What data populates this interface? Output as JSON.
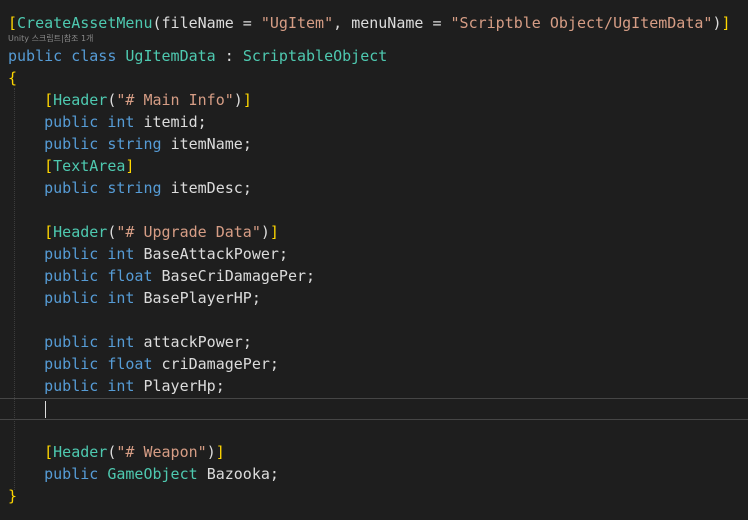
{
  "editor": {
    "codelens": "Unity 스크립트|참조 1개",
    "lines": [
      {
        "t": [
          [
            "br",
            "["
          ],
          [
            "ty",
            "CreateAssetMenu"
          ],
          [
            "pu",
            "("
          ],
          [
            "id",
            "fileName"
          ],
          [
            "pu",
            " = "
          ],
          [
            "st",
            "\"UgItem\""
          ],
          [
            "pu",
            ", "
          ],
          [
            "id",
            "menuName"
          ],
          [
            "pu",
            " = "
          ],
          [
            "st",
            "\"Scriptble Object/UgItemData\""
          ],
          [
            "pu",
            ")"
          ],
          [
            "br",
            "]"
          ]
        ]
      },
      {
        "t": [
          [
            "kw",
            "public"
          ],
          [
            "pu",
            " "
          ],
          [
            "kw",
            "class"
          ],
          [
            "pu",
            " "
          ],
          [
            "ty",
            "UgItemData"
          ],
          [
            "pu",
            " : "
          ],
          [
            "ty",
            "ScriptableObject"
          ]
        ]
      },
      {
        "t": [
          [
            "br",
            "{"
          ]
        ]
      },
      {
        "t": [
          [
            "pu",
            "    "
          ],
          [
            "br",
            "["
          ],
          [
            "ty",
            "Header"
          ],
          [
            "pu",
            "("
          ],
          [
            "st",
            "\"# Main Info\""
          ],
          [
            "pu",
            ")"
          ],
          [
            "br",
            "]"
          ]
        ]
      },
      {
        "t": [
          [
            "pu",
            "    "
          ],
          [
            "kw",
            "public"
          ],
          [
            "pu",
            " "
          ],
          [
            "kw",
            "int"
          ],
          [
            "pu",
            " "
          ],
          [
            "id",
            "itemid"
          ],
          [
            "pu",
            ";"
          ]
        ]
      },
      {
        "t": [
          [
            "pu",
            "    "
          ],
          [
            "kw",
            "public"
          ],
          [
            "pu",
            " "
          ],
          [
            "kw",
            "string"
          ],
          [
            "pu",
            " "
          ],
          [
            "id",
            "itemName"
          ],
          [
            "pu",
            ";"
          ]
        ]
      },
      {
        "t": [
          [
            "pu",
            "    "
          ],
          [
            "br",
            "["
          ],
          [
            "ty",
            "TextArea"
          ],
          [
            "br",
            "]"
          ]
        ]
      },
      {
        "t": [
          [
            "pu",
            "    "
          ],
          [
            "kw",
            "public"
          ],
          [
            "pu",
            " "
          ],
          [
            "kw",
            "string"
          ],
          [
            "pu",
            " "
          ],
          [
            "id",
            "itemDesc"
          ],
          [
            "pu",
            ";"
          ]
        ]
      },
      {
        "t": []
      },
      {
        "t": [
          [
            "pu",
            "    "
          ],
          [
            "br",
            "["
          ],
          [
            "ty",
            "Header"
          ],
          [
            "pu",
            "("
          ],
          [
            "st",
            "\"# Upgrade Data\""
          ],
          [
            "pu",
            ")"
          ],
          [
            "br",
            "]"
          ]
        ]
      },
      {
        "t": [
          [
            "pu",
            "    "
          ],
          [
            "kw",
            "public"
          ],
          [
            "pu",
            " "
          ],
          [
            "kw",
            "int"
          ],
          [
            "pu",
            " "
          ],
          [
            "id",
            "BaseAttackPower"
          ],
          [
            "pu",
            ";"
          ]
        ]
      },
      {
        "t": [
          [
            "pu",
            "    "
          ],
          [
            "kw",
            "public"
          ],
          [
            "pu",
            " "
          ],
          [
            "kw",
            "float"
          ],
          [
            "pu",
            " "
          ],
          [
            "id",
            "BaseCriDamagePer"
          ],
          [
            "pu",
            ";"
          ]
        ]
      },
      {
        "t": [
          [
            "pu",
            "    "
          ],
          [
            "kw",
            "public"
          ],
          [
            "pu",
            " "
          ],
          [
            "kw",
            "int"
          ],
          [
            "pu",
            " "
          ],
          [
            "id",
            "BasePlayerHP"
          ],
          [
            "pu",
            ";"
          ]
        ]
      },
      {
        "t": []
      },
      {
        "t": [
          [
            "pu",
            "    "
          ],
          [
            "kw",
            "public"
          ],
          [
            "pu",
            " "
          ],
          [
            "kw",
            "int"
          ],
          [
            "pu",
            " "
          ],
          [
            "id",
            "attackPower"
          ],
          [
            "pu",
            ";"
          ]
        ]
      },
      {
        "t": [
          [
            "pu",
            "    "
          ],
          [
            "kw",
            "public"
          ],
          [
            "pu",
            " "
          ],
          [
            "kw",
            "float"
          ],
          [
            "pu",
            " "
          ],
          [
            "id",
            "criDamagePer"
          ],
          [
            "pu",
            ";"
          ]
        ]
      },
      {
        "t": [
          [
            "pu",
            "    "
          ],
          [
            "kw",
            "public"
          ],
          [
            "pu",
            " "
          ],
          [
            "kw",
            "int"
          ],
          [
            "pu",
            " "
          ],
          [
            "id",
            "PlayerHp"
          ],
          [
            "pu",
            ";"
          ]
        ]
      },
      {
        "t": []
      },
      {
        "t": []
      },
      {
        "t": [
          [
            "pu",
            "    "
          ],
          [
            "br",
            "["
          ],
          [
            "ty",
            "Header"
          ],
          [
            "pu",
            "("
          ],
          [
            "st",
            "\"# Weapon\""
          ],
          [
            "pu",
            ")"
          ],
          [
            "br",
            "]"
          ]
        ]
      },
      {
        "t": [
          [
            "pu",
            "    "
          ],
          [
            "kw",
            "public"
          ],
          [
            "pu",
            " "
          ],
          [
            "ty",
            "GameObject"
          ],
          [
            "pu",
            " "
          ],
          [
            "id",
            "Bazooka"
          ],
          [
            "pu",
            ";"
          ]
        ]
      },
      {
        "t": [
          [
            "br",
            "}"
          ]
        ]
      }
    ]
  },
  "colors": {
    "background": "#1e1e1e",
    "keyword": "#569cd6",
    "type": "#4ec9b0",
    "string": "#d69d85",
    "text": "#dcdcdc",
    "bracket": "#ffd700"
  }
}
